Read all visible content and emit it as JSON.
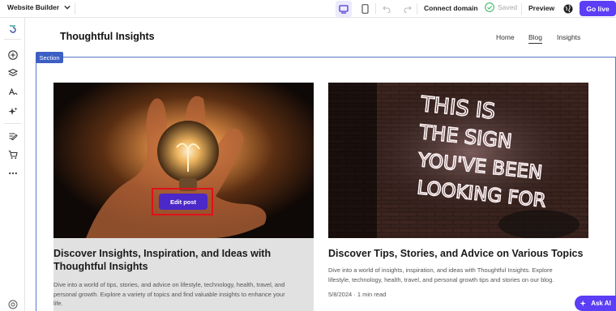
{
  "topbar": {
    "site_name": "Website Builder",
    "connect_domain": "Connect domain",
    "saved": "Saved",
    "preview": "Preview",
    "go_live": "Go live"
  },
  "site": {
    "title": "Thoughtful Insights",
    "nav": [
      "Home",
      "Blog",
      "Insights"
    ],
    "active_nav": "Blog"
  },
  "section_label": "Section",
  "posts": [
    {
      "title_line1": "Discover Insights, Inspiration, and Ideas with",
      "title_line2": "Thoughtful Insights",
      "excerpt_line1": "Dive into a world of tips, stories, and advice on lifestyle, technology, health, travel, and",
      "excerpt_line2": "personal growth. Explore a variety of topics and find valuable insights to enhance your",
      "excerpt_line3": "life.",
      "edit_label": "Edit post",
      "image": "hand-holding-lightbulb"
    },
    {
      "title": "Discover Tips, Stories, and Advice on Various Topics",
      "excerpt_line1": "Dive into a world of insights, inspiration, and ideas with Thoughtful Insights. Explore",
      "excerpt_line2": "lifestyle, technology, health, travel, and personal growth tips and stories on our blog.",
      "meta": "5/8/2024 · 1 min read",
      "image": "neon-sign-on-brick-wall",
      "neon_text": [
        "THIS IS",
        "THE SIGN",
        "YOU'VE BEEN",
        "LOOKING FOR"
      ]
    }
  ],
  "ask_ai": "Ask AI",
  "colors": {
    "accent": "#5b3ef5",
    "section": "#3d5fc4",
    "highlight": "#e0101a"
  }
}
